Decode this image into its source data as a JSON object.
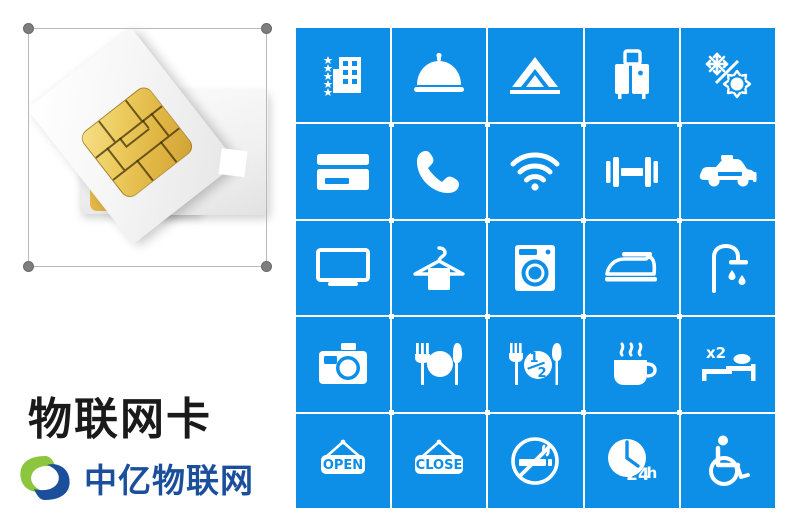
{
  "left_panel": {
    "selection": {
      "name": "image-selection-box",
      "handles": [
        "top-left",
        "top-right",
        "bottom-left",
        "bottom-right"
      ]
    },
    "artwork": {
      "name": "sim-card-illustration",
      "alt": "Two stacked SIM cards with gold chip contacts"
    },
    "brand_title": "物联网卡",
    "brand_name": "中亿物联网",
    "brand_colors": {
      "title": "#1a1a1a",
      "name": "#1b4f9c",
      "mark_green": "#8cc63f",
      "mark_blue": "#1b4f9c"
    }
  },
  "icon_grid": {
    "columns": 5,
    "rows": 5,
    "tile_color": "#0d8fe8",
    "glyph_color": "#ffffff",
    "gap_color": "#ffffff",
    "tiles": [
      {
        "name": "hotel-star-icon",
        "label": "Hotel / star rating"
      },
      {
        "name": "room-service-bell-icon",
        "label": "Room service"
      },
      {
        "name": "camping-tent-icon",
        "label": "Camping / tent"
      },
      {
        "name": "luggage-icon",
        "label": "Luggage storage"
      },
      {
        "name": "air-conditioning-icon",
        "label": "Air conditioning / heating"
      },
      {
        "name": "credit-card-icon",
        "label": "Card payment"
      },
      {
        "name": "telephone-icon",
        "label": "Telephone"
      },
      {
        "name": "wifi-icon",
        "label": "Wi-Fi"
      },
      {
        "name": "dumbbell-icon",
        "label": "Gym / fitness"
      },
      {
        "name": "taxi-icon",
        "label": "Taxi service"
      },
      {
        "name": "television-icon",
        "label": "Television"
      },
      {
        "name": "hanger-towel-icon",
        "label": "Wardrobe / towels"
      },
      {
        "name": "washing-machine-icon",
        "label": "Laundry"
      },
      {
        "name": "iron-icon",
        "label": "Ironing"
      },
      {
        "name": "shower-icon",
        "label": "Shower"
      },
      {
        "name": "camera-icon",
        "label": "Photography"
      },
      {
        "name": "restaurant-icon",
        "label": "Restaurant"
      },
      {
        "name": "half-board-icon",
        "label": "Half board"
      },
      {
        "name": "coffee-cup-icon",
        "label": "Coffee / breakfast"
      },
      {
        "name": "double-bed-icon",
        "label": "Double bed x2"
      },
      {
        "name": "open-sign-icon",
        "label": "OPEN"
      },
      {
        "name": "close-sign-icon",
        "label": "CLOSE"
      },
      {
        "name": "no-smoking-icon",
        "label": "No smoking"
      },
      {
        "name": "twentyfour-hour-icon",
        "label": "24 hour service"
      },
      {
        "name": "wheelchair-icon",
        "label": "Accessible"
      }
    ],
    "tile_text": {
      "open": "OPEN",
      "close": "CLOSE",
      "half_board_num": "1",
      "half_board_den": "2",
      "double_bed": "x2",
      "hours": "24",
      "hours_suffix": "h"
    }
  }
}
